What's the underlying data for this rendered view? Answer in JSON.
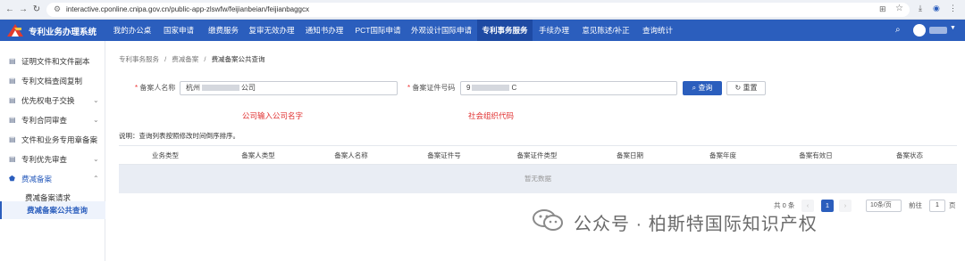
{
  "browser": {
    "url": "interactive.cponline.cnipa.gov.cn/public-app-zlswfw/feijianbeian/feijianbaggcx"
  },
  "header": {
    "app_title": "专利业务办理系统",
    "menu": [
      {
        "label": "我的办公桌"
      },
      {
        "label": "国家申请"
      },
      {
        "label": "缴费服务"
      },
      {
        "label": "复审无效办理"
      },
      {
        "label": "通知书办理"
      },
      {
        "label": "PCT国际申请"
      },
      {
        "label": "外观设计国际申请"
      },
      {
        "label": "专利事务服务",
        "active": true
      },
      {
        "label": "手续办理"
      },
      {
        "label": "意见陈述/补正"
      },
      {
        "label": "查询统计"
      }
    ]
  },
  "sidebar": {
    "items": [
      {
        "label": "证明文件和文件副本"
      },
      {
        "label": "专利文档查阅复制"
      },
      {
        "label": "优先权电子交换"
      },
      {
        "label": "专利合同审查"
      },
      {
        "label": "文件和业务专用章备案"
      },
      {
        "label": "专利优先审查"
      },
      {
        "label": "费减备案"
      }
    ],
    "sub_items": [
      {
        "label": "费减备案请求"
      },
      {
        "label": "费减备案公共查询",
        "active": true
      }
    ]
  },
  "breadcrumb": {
    "items": [
      "专利事务服务",
      "费减备案",
      "费减备案公共查询"
    ],
    "sep": "/"
  },
  "form": {
    "name_label": "备案人名称",
    "name_value_prefix": "杭州",
    "name_value_suffix": "公司",
    "cert_label": "备案证件号码",
    "cert_value_prefix": "9",
    "cert_value_suffix": "C",
    "required_mark": "*",
    "query_label": "查询",
    "reset_label": "重置"
  },
  "annotations": {
    "name_hint": "公司输入公司名字",
    "cert_hint": "社会组织代码"
  },
  "note": "说明：查询列表按照修改时间倒序排序。",
  "table": {
    "columns": [
      "业务类型",
      "备案人类型",
      "备案人名称",
      "备案证件号",
      "备案证件类型",
      "备案日期",
      "备案年度",
      "备案有效日",
      "备案状态"
    ],
    "empty_text": "暂无数据"
  },
  "pagination": {
    "total": "共 0 条",
    "current_page": "1",
    "page_size": "10条/页",
    "goto_label": "前往",
    "goto_value": "1",
    "page_suffix": "页"
  },
  "watermark": {
    "text": "公众号 · 柏斯特国际知识产权"
  },
  "colors": {
    "primary": "#2b5ebd",
    "annotation": "#e03030"
  }
}
